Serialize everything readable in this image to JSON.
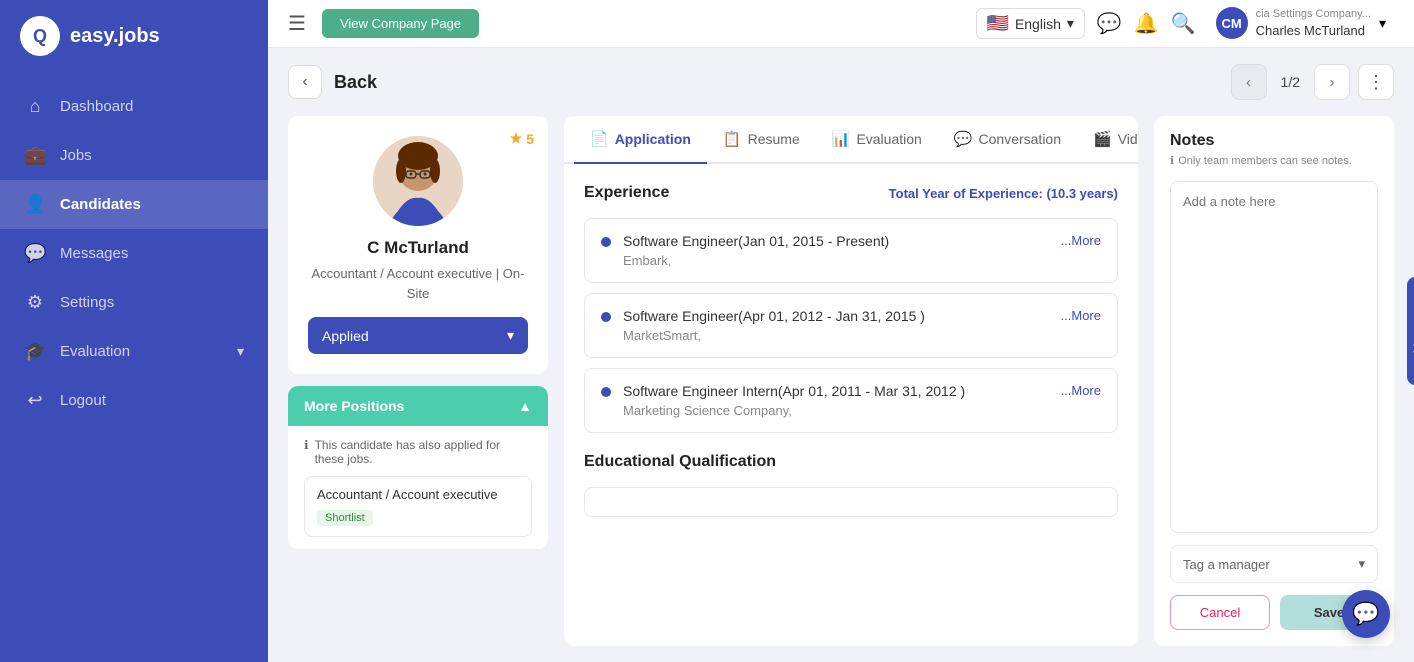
{
  "brand": {
    "logo_text": "easy.jobs",
    "logo_icon": "Q"
  },
  "sidebar": {
    "items": [
      {
        "id": "dashboard",
        "label": "Dashboard",
        "icon": "⌂",
        "active": false
      },
      {
        "id": "jobs",
        "label": "Jobs",
        "icon": "💼",
        "active": false
      },
      {
        "id": "candidates",
        "label": "Candidates",
        "icon": "👤",
        "active": true
      },
      {
        "id": "messages",
        "label": "Messages",
        "icon": "💬",
        "active": false
      },
      {
        "id": "settings",
        "label": "Settings",
        "icon": "⚙",
        "active": false
      },
      {
        "id": "evaluation",
        "label": "Evaluation",
        "icon": "🎓",
        "active": false
      },
      {
        "id": "logout",
        "label": "Logout",
        "icon": "↩",
        "active": false
      }
    ]
  },
  "topbar": {
    "menu_icon": "☰",
    "view_company_btn": "View Company Page",
    "language": "English",
    "user_name": "Charles McTurland",
    "user_company": "cia Settings Company...",
    "user_initials": "CM"
  },
  "back_header": {
    "back_label": "Back",
    "nav_count": "1/2"
  },
  "candidate": {
    "name": "C McTurland",
    "title": "Accountant / Account executive | On-Site",
    "star_count": "5",
    "status": "Applied",
    "avatar_emoji": "👩"
  },
  "more_positions": {
    "title": "More Positions",
    "note": "This candidate has also applied for these jobs.",
    "positions": [
      {
        "title": "Accountant / Account executive",
        "badge": "Shortlist"
      }
    ]
  },
  "tabs": [
    {
      "id": "application",
      "label": "Application",
      "icon": "📄",
      "active": true
    },
    {
      "id": "resume",
      "label": "Resume",
      "icon": "📋",
      "active": false
    },
    {
      "id": "evaluation",
      "label": "Evaluation",
      "icon": "📊",
      "active": false
    },
    {
      "id": "conversation",
      "label": "Conversation",
      "icon": "💬",
      "active": false
    },
    {
      "id": "video",
      "label": "Video",
      "icon": "🎬",
      "active": false
    }
  ],
  "experience": {
    "section_title": "Experience",
    "total_years_label": "Total Year of Experience:",
    "total_years_value": "(10.3 years)",
    "items": [
      {
        "title": "Software Engineer(Jan 01, 2015 - Present)",
        "company": "Embark,",
        "more": "...More"
      },
      {
        "title": "Software Engineer(Apr 01, 2012 - Jan 31, 2015 )",
        "company": "MarketSmart,",
        "more": "...More"
      },
      {
        "title": "Software Engineer Intern(Apr 01, 2011 - Mar 31, 2012 )",
        "company": "Marketing Science Company,",
        "more": "...More"
      }
    ]
  },
  "education": {
    "section_title": "Educational Qualification"
  },
  "notes": {
    "title": "Notes",
    "subtitle": "Only team members can see notes.",
    "placeholder": "Add a note here",
    "tag_manager_label": "Tag a manager",
    "cancel_label": "Cancel",
    "save_label": "Save"
  },
  "support": {
    "talk_label": "Talk to Support"
  },
  "colors": {
    "primary": "#3d4db7",
    "accent_green": "#4cceac",
    "star_color": "#f5a623"
  }
}
